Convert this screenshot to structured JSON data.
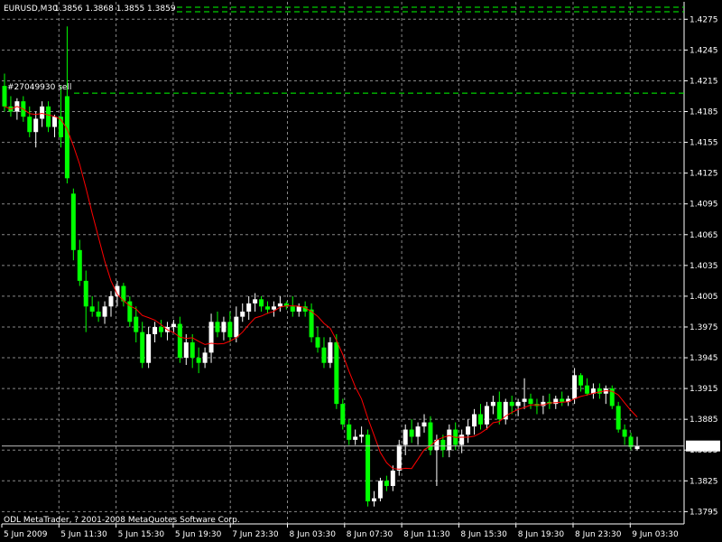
{
  "header": {
    "symbol": "EURUSD,M30",
    "ohlc": "1.3856 1.3868 1.3855 1.3859"
  },
  "order_label": "#27049930 sell",
  "copyright": "ODL MetaTrader, ? 2001-2008 MetaQuotes Software Corp.",
  "current_price_label": "1.3859",
  "colors": {
    "background": "#000000",
    "grid": "#888888",
    "bull": "#ffffff",
    "bear": "#00ff00",
    "ma": "#ff0000",
    "order_line": "#00ff00",
    "text": "#ffffff"
  },
  "chart_data": {
    "type": "candlestick",
    "ylim": [
      1.3783,
      1.4292
    ],
    "y_ticks": [
      "1.4275",
      "1.4245",
      "1.4215",
      "1.4185",
      "1.4155",
      "1.4125",
      "1.4095",
      "1.4065",
      "1.4035",
      "1.4005",
      "1.3975",
      "1.3945",
      "1.3915",
      "1.3885",
      "1.3855",
      "1.3825",
      "1.3795"
    ],
    "x_ticks": [
      "5 Jun 2009",
      "5 Jun 11:30",
      "5 Jun 15:30",
      "5 Jun 19:30",
      "7 Jun 23:30",
      "8 Jun 03:30",
      "8 Jun 07:30",
      "8 Jun 11:30",
      "8 Jun 15:30",
      "8 Jun 19:30",
      "8 Jun 23:30",
      "9 Jun 03:30"
    ],
    "order_level": 1.4203,
    "current_price": 1.3859,
    "ma_period": 8,
    "candles": [
      {
        "o": 1.421,
        "h": 1.4222,
        "l": 1.4185,
        "c": 1.419
      },
      {
        "o": 1.419,
        "h": 1.42,
        "l": 1.418,
        "c": 1.4185
      },
      {
        "o": 1.4185,
        "h": 1.4198,
        "l": 1.4177,
        "c": 1.4195
      },
      {
        "o": 1.4195,
        "h": 1.42,
        "l": 1.4175,
        "c": 1.418
      },
      {
        "o": 1.418,
        "h": 1.419,
        "l": 1.416,
        "c": 1.4165
      },
      {
        "o": 1.4165,
        "h": 1.4185,
        "l": 1.415,
        "c": 1.4178
      },
      {
        "o": 1.4178,
        "h": 1.4195,
        "l": 1.417,
        "c": 1.419
      },
      {
        "o": 1.419,
        "h": 1.4195,
        "l": 1.4165,
        "c": 1.417
      },
      {
        "o": 1.417,
        "h": 1.4182,
        "l": 1.416,
        "c": 1.418
      },
      {
        "o": 1.418,
        "h": 1.421,
        "l": 1.415,
        "c": 1.416
      },
      {
        "o": 1.42,
        "h": 1.4268,
        "l": 1.4115,
        "c": 1.412
      },
      {
        "o": 1.4105,
        "h": 1.411,
        "l": 1.404,
        "c": 1.405
      },
      {
        "o": 1.405,
        "h": 1.406,
        "l": 1.4015,
        "c": 1.402
      },
      {
        "o": 1.402,
        "h": 1.403,
        "l": 1.397,
        "c": 1.3995
      },
      {
        "o": 1.3995,
        "h": 1.4005,
        "l": 1.3985,
        "c": 1.399
      },
      {
        "o": 1.399,
        "h": 1.4,
        "l": 1.398,
        "c": 1.3985
      },
      {
        "o": 1.3985,
        "h": 1.4,
        "l": 1.3978,
        "c": 1.3995
      },
      {
        "o": 1.3995,
        "h": 1.401,
        "l": 1.3985,
        "c": 1.4005
      },
      {
        "o": 1.4005,
        "h": 1.402,
        "l": 1.3995,
        "c": 1.4015
      },
      {
        "o": 1.4015,
        "h": 1.4018,
        "l": 1.3995,
        "c": 1.4
      },
      {
        "o": 1.4,
        "h": 1.4005,
        "l": 1.3975,
        "c": 1.398
      },
      {
        "o": 1.3985,
        "h": 1.3995,
        "l": 1.396,
        "c": 1.397
      },
      {
        "o": 1.397,
        "h": 1.398,
        "l": 1.3935,
        "c": 1.394
      },
      {
        "o": 1.394,
        "h": 1.3975,
        "l": 1.3935,
        "c": 1.3968
      },
      {
        "o": 1.3968,
        "h": 1.398,
        "l": 1.396,
        "c": 1.3975
      },
      {
        "o": 1.3975,
        "h": 1.3982,
        "l": 1.3965,
        "c": 1.397
      },
      {
        "o": 1.397,
        "h": 1.398,
        "l": 1.3962,
        "c": 1.3975
      },
      {
        "o": 1.3975,
        "h": 1.3982,
        "l": 1.397,
        "c": 1.3978
      },
      {
        "o": 1.3978,
        "h": 1.3985,
        "l": 1.394,
        "c": 1.3945
      },
      {
        "o": 1.3945,
        "h": 1.3968,
        "l": 1.3938,
        "c": 1.396
      },
      {
        "o": 1.396,
        "h": 1.3968,
        "l": 1.3935,
        "c": 1.3945
      },
      {
        "o": 1.3945,
        "h": 1.3955,
        "l": 1.393,
        "c": 1.394
      },
      {
        "o": 1.394,
        "h": 1.3955,
        "l": 1.3935,
        "c": 1.395
      },
      {
        "o": 1.395,
        "h": 1.3988,
        "l": 1.394,
        "c": 1.398
      },
      {
        "o": 1.398,
        "h": 1.399,
        "l": 1.3965,
        "c": 1.397
      },
      {
        "o": 1.397,
        "h": 1.3985,
        "l": 1.3962,
        "c": 1.398
      },
      {
        "o": 1.398,
        "h": 1.399,
        "l": 1.396,
        "c": 1.3965
      },
      {
        "o": 1.3965,
        "h": 1.3995,
        "l": 1.396,
        "c": 1.3985
      },
      {
        "o": 1.3985,
        "h": 1.3998,
        "l": 1.398,
        "c": 1.399
      },
      {
        "o": 1.399,
        "h": 1.4005,
        "l": 1.3982,
        "c": 1.3998
      },
      {
        "o": 1.3998,
        "h": 1.4008,
        "l": 1.399,
        "c": 1.4002
      },
      {
        "o": 1.4002,
        "h": 1.4005,
        "l": 1.399,
        "c": 1.3995
      },
      {
        "o": 1.3995,
        "h": 1.4,
        "l": 1.3988,
        "c": 1.3992
      },
      {
        "o": 1.3992,
        "h": 1.4,
        "l": 1.3985,
        "c": 1.3995
      },
      {
        "o": 1.3995,
        "h": 1.4005,
        "l": 1.399,
        "c": 1.3998
      },
      {
        "o": 1.3998,
        "h": 1.4,
        "l": 1.3992,
        "c": 1.3995
      },
      {
        "o": 1.3995,
        "h": 1.4005,
        "l": 1.3985,
        "c": 1.399
      },
      {
        "o": 1.399,
        "h": 1.3998,
        "l": 1.3985,
        "c": 1.3995
      },
      {
        "o": 1.3995,
        "h": 1.4,
        "l": 1.3985,
        "c": 1.399
      },
      {
        "o": 1.3992,
        "h": 1.3998,
        "l": 1.396,
        "c": 1.3965
      },
      {
        "o": 1.3965,
        "h": 1.3975,
        "l": 1.395,
        "c": 1.3955
      },
      {
        "o": 1.3955,
        "h": 1.3965,
        "l": 1.3935,
        "c": 1.394
      },
      {
        "o": 1.394,
        "h": 1.3965,
        "l": 1.3935,
        "c": 1.396
      },
      {
        "o": 1.396,
        "h": 1.3968,
        "l": 1.3895,
        "c": 1.39
      },
      {
        "o": 1.39,
        "h": 1.3905,
        "l": 1.3875,
        "c": 1.388
      },
      {
        "o": 1.388,
        "h": 1.3885,
        "l": 1.386,
        "c": 1.3865
      },
      {
        "o": 1.3865,
        "h": 1.3875,
        "l": 1.386,
        "c": 1.3868
      },
      {
        "o": 1.3868,
        "h": 1.3878,
        "l": 1.3862,
        "c": 1.387
      },
      {
        "o": 1.387,
        "h": 1.3875,
        "l": 1.38,
        "c": 1.3805
      },
      {
        "o": 1.3805,
        "h": 1.3815,
        "l": 1.38,
        "c": 1.3808
      },
      {
        "o": 1.3808,
        "h": 1.3828,
        "l": 1.3805,
        "c": 1.3825
      },
      {
        "o": 1.3825,
        "h": 1.383,
        "l": 1.3815,
        "c": 1.382
      },
      {
        "o": 1.382,
        "h": 1.384,
        "l": 1.3815,
        "c": 1.3835
      },
      {
        "o": 1.3835,
        "h": 1.3865,
        "l": 1.383,
        "c": 1.386
      },
      {
        "o": 1.386,
        "h": 1.388,
        "l": 1.385,
        "c": 1.3875
      },
      {
        "o": 1.3875,
        "h": 1.3885,
        "l": 1.3862,
        "c": 1.3868
      },
      {
        "o": 1.3868,
        "h": 1.3882,
        "l": 1.386,
        "c": 1.3878
      },
      {
        "o": 1.3878,
        "h": 1.389,
        "l": 1.3872,
        "c": 1.3882
      },
      {
        "o": 1.3882,
        "h": 1.3888,
        "l": 1.385,
        "c": 1.3855
      },
      {
        "o": 1.3855,
        "h": 1.387,
        "l": 1.382,
        "c": 1.3865
      },
      {
        "o": 1.3865,
        "h": 1.387,
        "l": 1.3848,
        "c": 1.3855
      },
      {
        "o": 1.3855,
        "h": 1.388,
        "l": 1.3848,
        "c": 1.3875
      },
      {
        "o": 1.3875,
        "h": 1.3882,
        "l": 1.3855,
        "c": 1.386
      },
      {
        "o": 1.386,
        "h": 1.3875,
        "l": 1.3852,
        "c": 1.387
      },
      {
        "o": 1.387,
        "h": 1.3885,
        "l": 1.3862,
        "c": 1.3878
      },
      {
        "o": 1.3878,
        "h": 1.3895,
        "l": 1.387,
        "c": 1.389
      },
      {
        "o": 1.389,
        "h": 1.39,
        "l": 1.3875,
        "c": 1.388
      },
      {
        "o": 1.388,
        "h": 1.3902,
        "l": 1.3875,
        "c": 1.3898
      },
      {
        "o": 1.3898,
        "h": 1.3908,
        "l": 1.389,
        "c": 1.3902
      },
      {
        "o": 1.3902,
        "h": 1.3912,
        "l": 1.388,
        "c": 1.3885
      },
      {
        "o": 1.3885,
        "h": 1.3905,
        "l": 1.388,
        "c": 1.3902
      },
      {
        "o": 1.3902,
        "h": 1.3908,
        "l": 1.389,
        "c": 1.3898
      },
      {
        "o": 1.3898,
        "h": 1.3905,
        "l": 1.3888,
        "c": 1.3902
      },
      {
        "o": 1.3902,
        "h": 1.3925,
        "l": 1.3895,
        "c": 1.3905
      },
      {
        "o": 1.3905,
        "h": 1.391,
        "l": 1.3895,
        "c": 1.39
      },
      {
        "o": 1.39,
        "h": 1.3905,
        "l": 1.389,
        "c": 1.3898
      },
      {
        "o": 1.3898,
        "h": 1.3908,
        "l": 1.389,
        "c": 1.3902
      },
      {
        "o": 1.3902,
        "h": 1.391,
        "l": 1.3895,
        "c": 1.39
      },
      {
        "o": 1.39,
        "h": 1.3908,
        "l": 1.3895,
        "c": 1.3905
      },
      {
        "o": 1.3905,
        "h": 1.3912,
        "l": 1.3898,
        "c": 1.3902
      },
      {
        "o": 1.3902,
        "h": 1.3908,
        "l": 1.3898,
        "c": 1.3905
      },
      {
        "o": 1.3905,
        "h": 1.3935,
        "l": 1.39,
        "c": 1.3928
      },
      {
        "o": 1.3928,
        "h": 1.393,
        "l": 1.3912,
        "c": 1.3918
      },
      {
        "o": 1.3918,
        "h": 1.3925,
        "l": 1.3908,
        "c": 1.391
      },
      {
        "o": 1.391,
        "h": 1.392,
        "l": 1.3905,
        "c": 1.3915
      },
      {
        "o": 1.3915,
        "h": 1.392,
        "l": 1.3905,
        "c": 1.391
      },
      {
        "o": 1.391,
        "h": 1.3918,
        "l": 1.39,
        "c": 1.3915
      },
      {
        "o": 1.3915,
        "h": 1.3918,
        "l": 1.3895,
        "c": 1.3898
      },
      {
        "o": 1.3898,
        "h": 1.3902,
        "l": 1.3872,
        "c": 1.3875
      },
      {
        "o": 1.3875,
        "h": 1.388,
        "l": 1.386,
        "c": 1.3868
      },
      {
        "o": 1.3868,
        "h": 1.3872,
        "l": 1.3855,
        "c": 1.3858
      },
      {
        "o": 1.3856,
        "h": 1.3868,
        "l": 1.3855,
        "c": 1.3859
      }
    ]
  }
}
